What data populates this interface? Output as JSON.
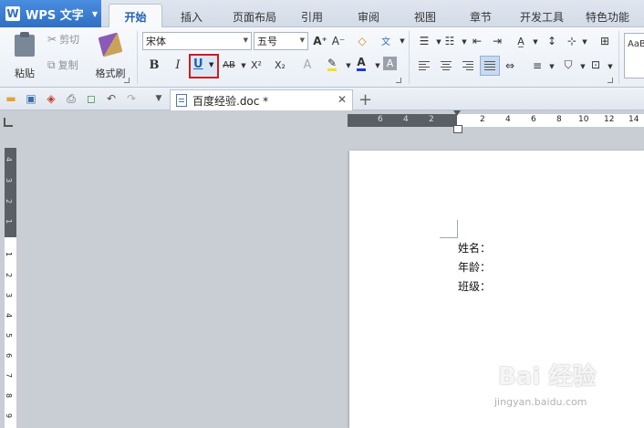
{
  "app": {
    "name": "WPS 文字",
    "logo_letter": "W"
  },
  "menu_tabs": [
    "开始",
    "插入",
    "页面布局",
    "引用",
    "审阅",
    "视图",
    "章节",
    "开发工具",
    "特色功能"
  ],
  "ribbon": {
    "paste_label": "粘贴",
    "cut_label": "剪切",
    "copy_label": "复制",
    "format_painter_label": "格式刷",
    "font_name": "宋体",
    "font_size": "五号",
    "bold": "B",
    "italic": "I",
    "underline": "U",
    "strike": "AB",
    "superscript": "X²",
    "subscript": "X₂",
    "font_color_letter": "A",
    "grow_font": "A⁺",
    "shrink_font": "A⁻",
    "phonetic": "文",
    "style_preview": "AaB"
  },
  "document_tab": {
    "title": "百度经验.doc *"
  },
  "ruler": {
    "h_dark": [
      "6",
      "4",
      "2"
    ],
    "h_light": [
      "2",
      "4",
      "6",
      "8",
      "10",
      "12",
      "14"
    ],
    "v_dark": [
      "4",
      "3",
      "2",
      "1"
    ],
    "v_light": [
      "1",
      "2",
      "3",
      "4",
      "5",
      "6",
      "7",
      "8",
      "9"
    ]
  },
  "document": {
    "lines": [
      "姓名：",
      "年龄：",
      "班级："
    ]
  },
  "watermark": {
    "main": "Bai 经验",
    "sub": "jingyan.baidu.com"
  },
  "colors": {
    "app_blue": "#2f6fc4",
    "highlight_red": "#d01d1d",
    "ruler_dark": "#5a5f66"
  }
}
